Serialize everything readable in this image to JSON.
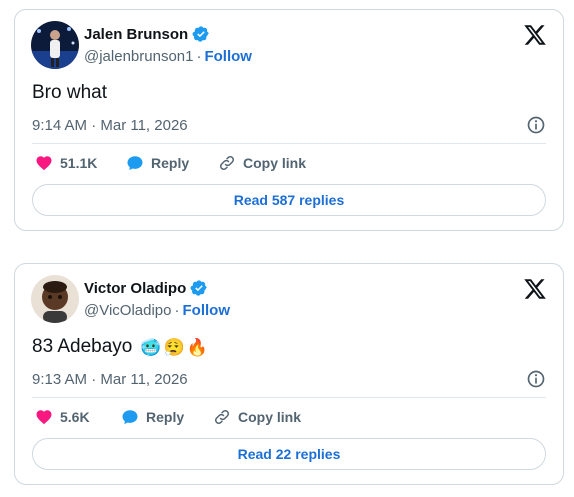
{
  "tweets": [
    {
      "name": "Jalen Brunson",
      "handle": "@jalenbrunson1",
      "separator": "·",
      "follow_label": "Follow",
      "text": "Bro what",
      "emojis": [],
      "timestamp": "9:14 AM · Mar 11, 2026",
      "like_count": "51.1K",
      "reply_label": "Reply",
      "copy_link_label": "Copy link",
      "read_replies_label": "Read 587 replies"
    },
    {
      "name": "Victor Oladipo",
      "handle": "@VicOladipo",
      "separator": "·",
      "follow_label": "Follow",
      "text": "83 Adebayo",
      "emojis": [
        "🥶",
        "😮‍💨",
        "🔥"
      ],
      "timestamp": "9:13 AM · Mar 11, 2026",
      "like_count": "5.6K",
      "reply_label": "Reply",
      "copy_link_label": "Copy link",
      "read_replies_label": "Read 22 replies"
    }
  ],
  "colors": {
    "like_red": "#f91880",
    "reply_blue": "#1d9bf0",
    "link_blue": "#1d6fd6",
    "verified_blue": "#1d9bf0",
    "muted_text": "#536471"
  },
  "icons": [
    "verified-badge-icon",
    "x-logo-icon",
    "info-icon",
    "heart-icon",
    "reply-bubble-icon",
    "link-icon"
  ]
}
